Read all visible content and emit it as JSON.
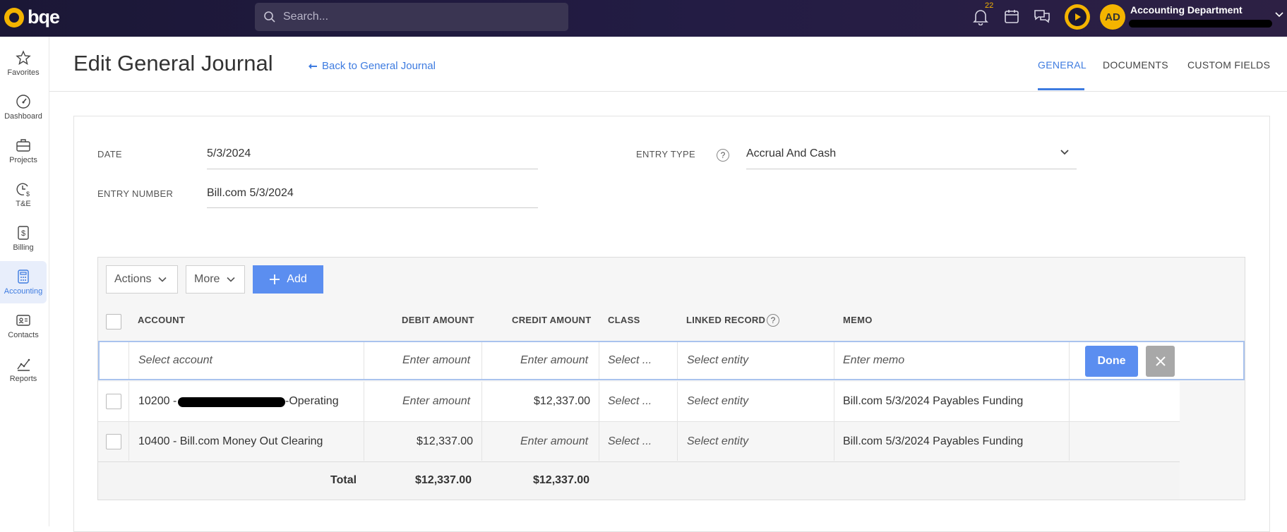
{
  "app": {
    "logo_text": "bqe"
  },
  "search": {
    "placeholder": "Search..."
  },
  "topbar": {
    "notification_count": "22",
    "avatar_initials": "AD",
    "department": "Accounting Department",
    "colors": {
      "bar": "#1b1736",
      "accent": "#f4b400"
    }
  },
  "sidebar": {
    "items": [
      {
        "label": "Favorites",
        "icon": "star-icon"
      },
      {
        "label": "Dashboard",
        "icon": "gauge-icon"
      },
      {
        "label": "Projects",
        "icon": "briefcase-icon"
      },
      {
        "label": "T&E",
        "icon": "clock-dollar-icon"
      },
      {
        "label": "Billing",
        "icon": "invoice-dollar-icon"
      },
      {
        "label": "Accounting",
        "icon": "calculator-icon",
        "active": true
      },
      {
        "label": "Contacts",
        "icon": "contact-card-icon"
      },
      {
        "label": "Reports",
        "icon": "line-chart-icon"
      }
    ]
  },
  "page": {
    "title": "Edit General Journal",
    "back_link": "Back to General Journal",
    "tabs": [
      {
        "label": "GENERAL",
        "active": true
      },
      {
        "label": "DOCUMENTS"
      },
      {
        "label": "CUSTOM FIELDS"
      }
    ]
  },
  "form": {
    "date_label": "DATE",
    "date_value": "5/3/2024",
    "entry_number_label": "ENTRY NUMBER",
    "entry_number_value": "Bill.com 5/3/2024",
    "entry_type_label": "ENTRY TYPE",
    "entry_type_value": "Accrual And Cash",
    "help_glyph": "?"
  },
  "toolbar": {
    "actions_label": "Actions",
    "more_label": "More",
    "add_label": "Add"
  },
  "grid": {
    "columns": {
      "account": "ACCOUNT",
      "debit": "DEBIT AMOUNT",
      "credit": "CREDIT AMOUNT",
      "class": "CLASS",
      "linked": "LINKED RECORD",
      "memo": "MEMO"
    },
    "edit_row": {
      "account_placeholder": "Select account",
      "debit_placeholder": "Enter amount",
      "credit_placeholder": "Enter amount",
      "class_placeholder": "Select ...",
      "linked_placeholder": "Select entity",
      "memo_placeholder": "Enter memo",
      "done_label": "Done"
    },
    "rows": [
      {
        "account_prefix": "10200 -",
        "account_suffix": "-Operating",
        "debit": "Enter amount",
        "credit": "$12,337.00",
        "class": "Select ...",
        "linked": "Select entity",
        "memo": "Bill.com 5/3/2024 Payables Funding"
      },
      {
        "account": "10400 - Bill.com Money Out Clearing",
        "debit": "$12,337.00",
        "credit": "Enter amount",
        "class": "Select ...",
        "linked": "Select entity",
        "memo": "Bill.com 5/3/2024 Payables Funding"
      }
    ],
    "total": {
      "label": "Total",
      "debit": "$12,337.00",
      "credit": "$12,337.00"
    }
  }
}
